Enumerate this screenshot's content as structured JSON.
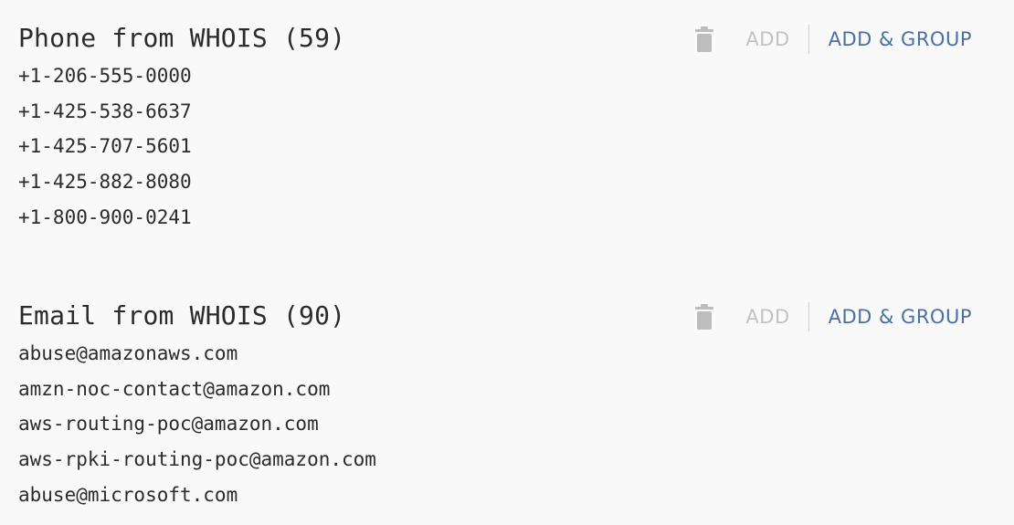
{
  "sections": [
    {
      "title": "Phone from WHOIS (59)",
      "add_label": "ADD",
      "add_group_label": "ADD & GROUP",
      "icon": "trash-icon",
      "items": [
        "+1-206-555-0000",
        "+1-425-538-6637",
        "+1-425-707-5601",
        "+1-425-882-8080",
        "+1-800-900-0241"
      ]
    },
    {
      "title": "Email from WHOIS (90)",
      "add_label": "ADD",
      "add_group_label": "ADD & GROUP",
      "icon": "trash-icon",
      "items": [
        "abuse@amazonaws.com",
        "amzn-noc-contact@amazon.com",
        "aws-routing-poc@amazon.com",
        "aws-rpki-routing-poc@amazon.com",
        "abuse@microsoft.com"
      ]
    }
  ],
  "colors": {
    "background": "#f9f9f9",
    "text": "#2b2b2b",
    "disabled": "#c2c2c2",
    "accent": "#4a6fa5",
    "icon": "#bdbdbd"
  }
}
